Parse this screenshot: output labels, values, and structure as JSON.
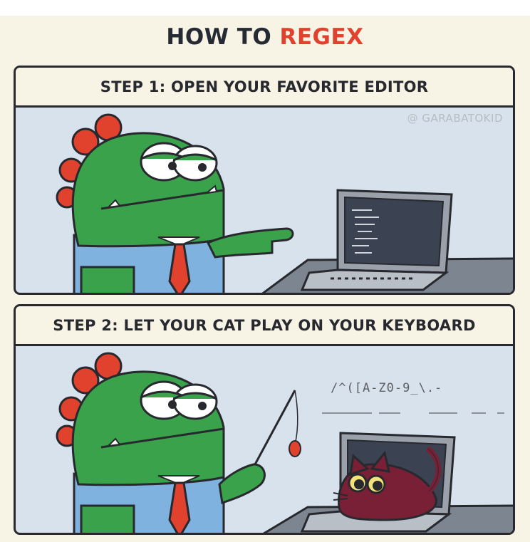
{
  "comic": {
    "title_prefix": "HOW TO ",
    "title_accent": "REGEX",
    "panels": [
      {
        "caption": "STEP 1: OPEN YOUR FAVORITE EDITOR",
        "watermark": "@ GARABATOKID"
      },
      {
        "caption": "STEP 2: LET YOUR CAT PLAY ON YOUR KEYBOARD",
        "screen_text": "/^([A-Z0-9_\\.-"
      }
    ]
  },
  "colors": {
    "accent": "#e0422e",
    "dino_green": "#3aa24a",
    "shirt_blue": "#7fb2de",
    "tie_red": "#e0422e",
    "cat_maroon": "#7a2036",
    "panel_bg": "#d8e2ec",
    "paper": "#f8f4e5"
  },
  "icons": [
    "dinosaur-character",
    "laptop",
    "cat",
    "cat-toy-wand"
  ]
}
